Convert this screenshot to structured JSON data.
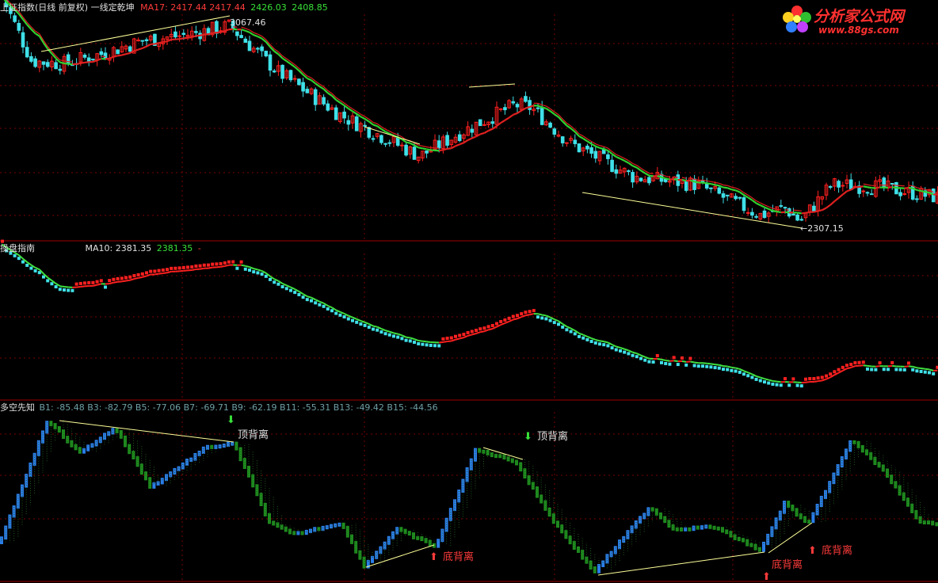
{
  "panel_main": {
    "title": "上证指数(日线 前复权) 一线定乾坤",
    "ma_label": "MA17: 2417.44",
    "values": [
      "2417.44",
      "2426.03",
      "2408.85"
    ],
    "high_label": "3067.46",
    "low_label": "2307.15"
  },
  "panel_mid": {
    "title": "操盘指南",
    "ma_label": "MA10: 2381.35",
    "values": [
      "2381.35",
      "-"
    ]
  },
  "panel_bot": {
    "title": "多空先知",
    "b_values": "B1: -85.48  B3: -82.79  B5: -77.06  B7: -69.71  B9: -62.19  B11: -55.31  B13: -49.42  B15: -44.56"
  },
  "annotations": {
    "top_div": "顶背离",
    "bottom_div": "底背离"
  },
  "logo": {
    "name": "分析家公式网",
    "url": "www.88gs.com"
  },
  "colors": {
    "up": "#ff2020",
    "down": "#3fe0e8",
    "ma_up": "#e02020",
    "ma_down": "#30d030",
    "grid": "#7a0000",
    "blue": "#2a7de8",
    "green": "#1e8e1e",
    "trend": "#ffff99"
  },
  "chart_data": [
    {
      "type": "candlestick",
      "title": "上证指数(日线 前复权) 一线定乾坤",
      "series_names": [
        "MA17"
      ],
      "key_levels": {
        "high": 3067.46,
        "low": 2307.15
      },
      "anchors_index": [
        3200,
        2930,
        2920,
        2960,
        3010,
        3030,
        3067,
        2890,
        2720,
        2560,
        2650,
        2760,
        2750,
        2610,
        2480,
        2450,
        2330,
        2360,
        2307,
        2450,
        2440,
        2400
      ],
      "anchors_x": [
        0,
        40,
        80,
        130,
        180,
        230,
        290,
        350,
        430,
        530,
        580,
        650,
        670,
        720,
        800,
        880,
        960,
        990,
        1010,
        1050,
        1110,
        1184
      ]
    },
    {
      "type": "line",
      "title": "操盘指南",
      "series_names": [
        "MA10"
      ],
      "last_value": 2381.35
    },
    {
      "type": "bar",
      "title": "多空先知",
      "series_names": [
        "B1",
        "B3",
        "B5",
        "B7",
        "B9",
        "B11",
        "B13",
        "B15"
      ],
      "last_values": [
        -85.48,
        -82.79,
        -77.06,
        -69.71,
        -62.19,
        -55.31,
        -49.42,
        -44.56
      ],
      "divergences": [
        "顶背离",
        "顶背离",
        "底背离",
        "底背离",
        "底背离"
      ]
    }
  ]
}
